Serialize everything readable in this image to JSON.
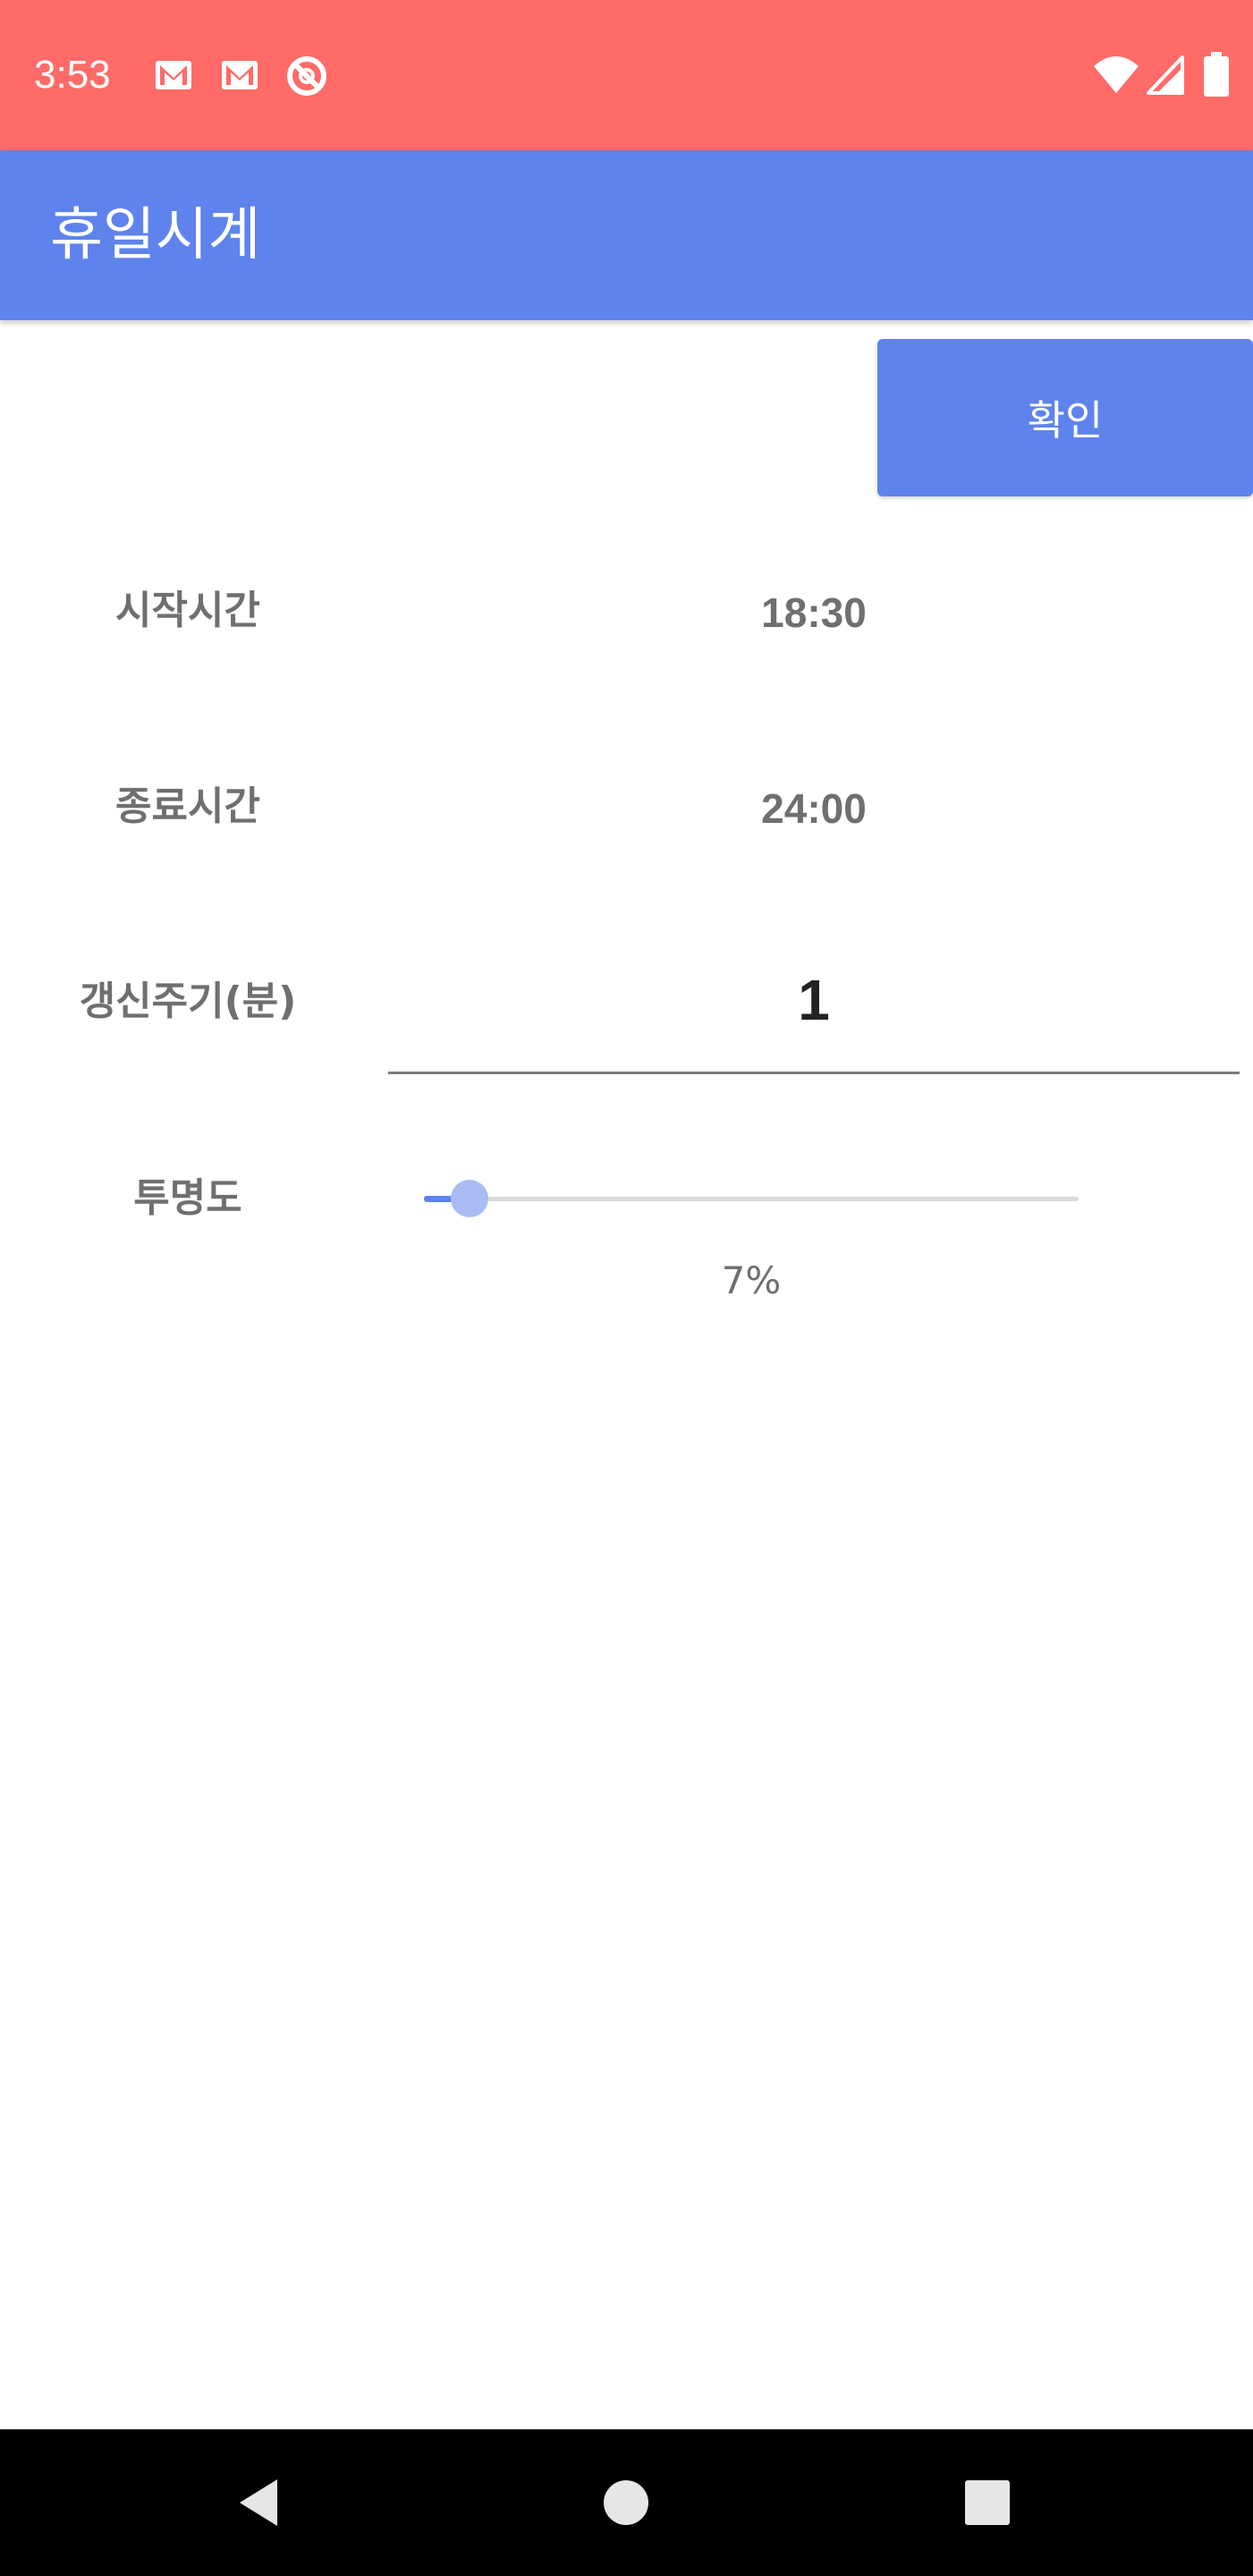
{
  "status_bar": {
    "time": "3:53",
    "background": "#ff6b68",
    "left_icons": [
      "gmail-icon",
      "gmail-icon",
      "do-not-disturb-icon"
    ],
    "right_icons": [
      "wifi-icon",
      "cellular-signal-icon",
      "battery-icon"
    ]
  },
  "app_bar": {
    "title": "휴일시계",
    "background": "#5f83ec"
  },
  "confirm_button": {
    "label": "확인"
  },
  "form": {
    "start_time": {
      "label": "시작시간",
      "value": "18:30"
    },
    "end_time": {
      "label": "종료시간",
      "value": "24:00"
    },
    "refresh_interval": {
      "label": "갱신주기(분)",
      "value": "1"
    },
    "transparency": {
      "label": "투명도",
      "value_text": "7%",
      "value": 7,
      "max": 100
    }
  },
  "nav_bar": {
    "buttons": [
      "back-icon",
      "home-icon",
      "recents-icon"
    ]
  }
}
